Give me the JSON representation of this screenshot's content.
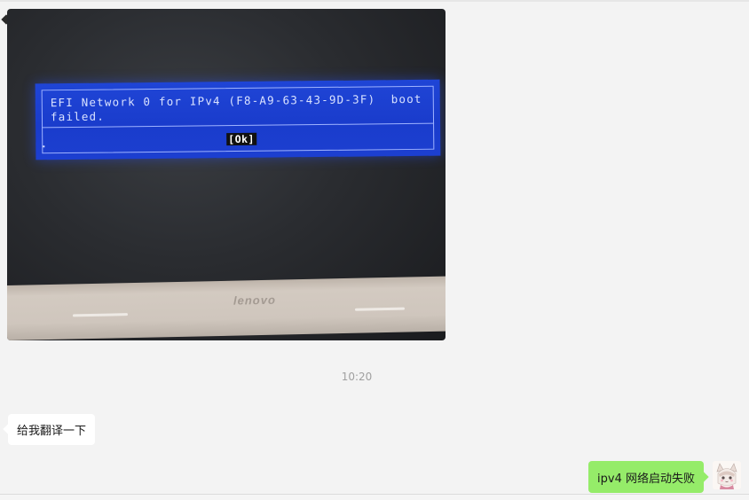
{
  "messages": {
    "image_message": {
      "dialog_text": "EFI Network 0 for IPv4 (F8-A9-63-43-9D-3F)  boot\nfailed.",
      "ok_label": "[Ok]",
      "bezel_brand": "lenovo"
    },
    "timestamp": "10:20",
    "incoming_text": "给我翻译一下",
    "outgoing_text": "ipv4 网络启动失败"
  },
  "colors": {
    "background": "#f3f3f3",
    "incoming_bubble": "#ffffff",
    "outgoing_bubble": "#95ec69",
    "bios_blue": "#1a3ccc",
    "timestamp": "#a0a0a0"
  },
  "icons": {
    "avatar": "anime-avatar"
  }
}
